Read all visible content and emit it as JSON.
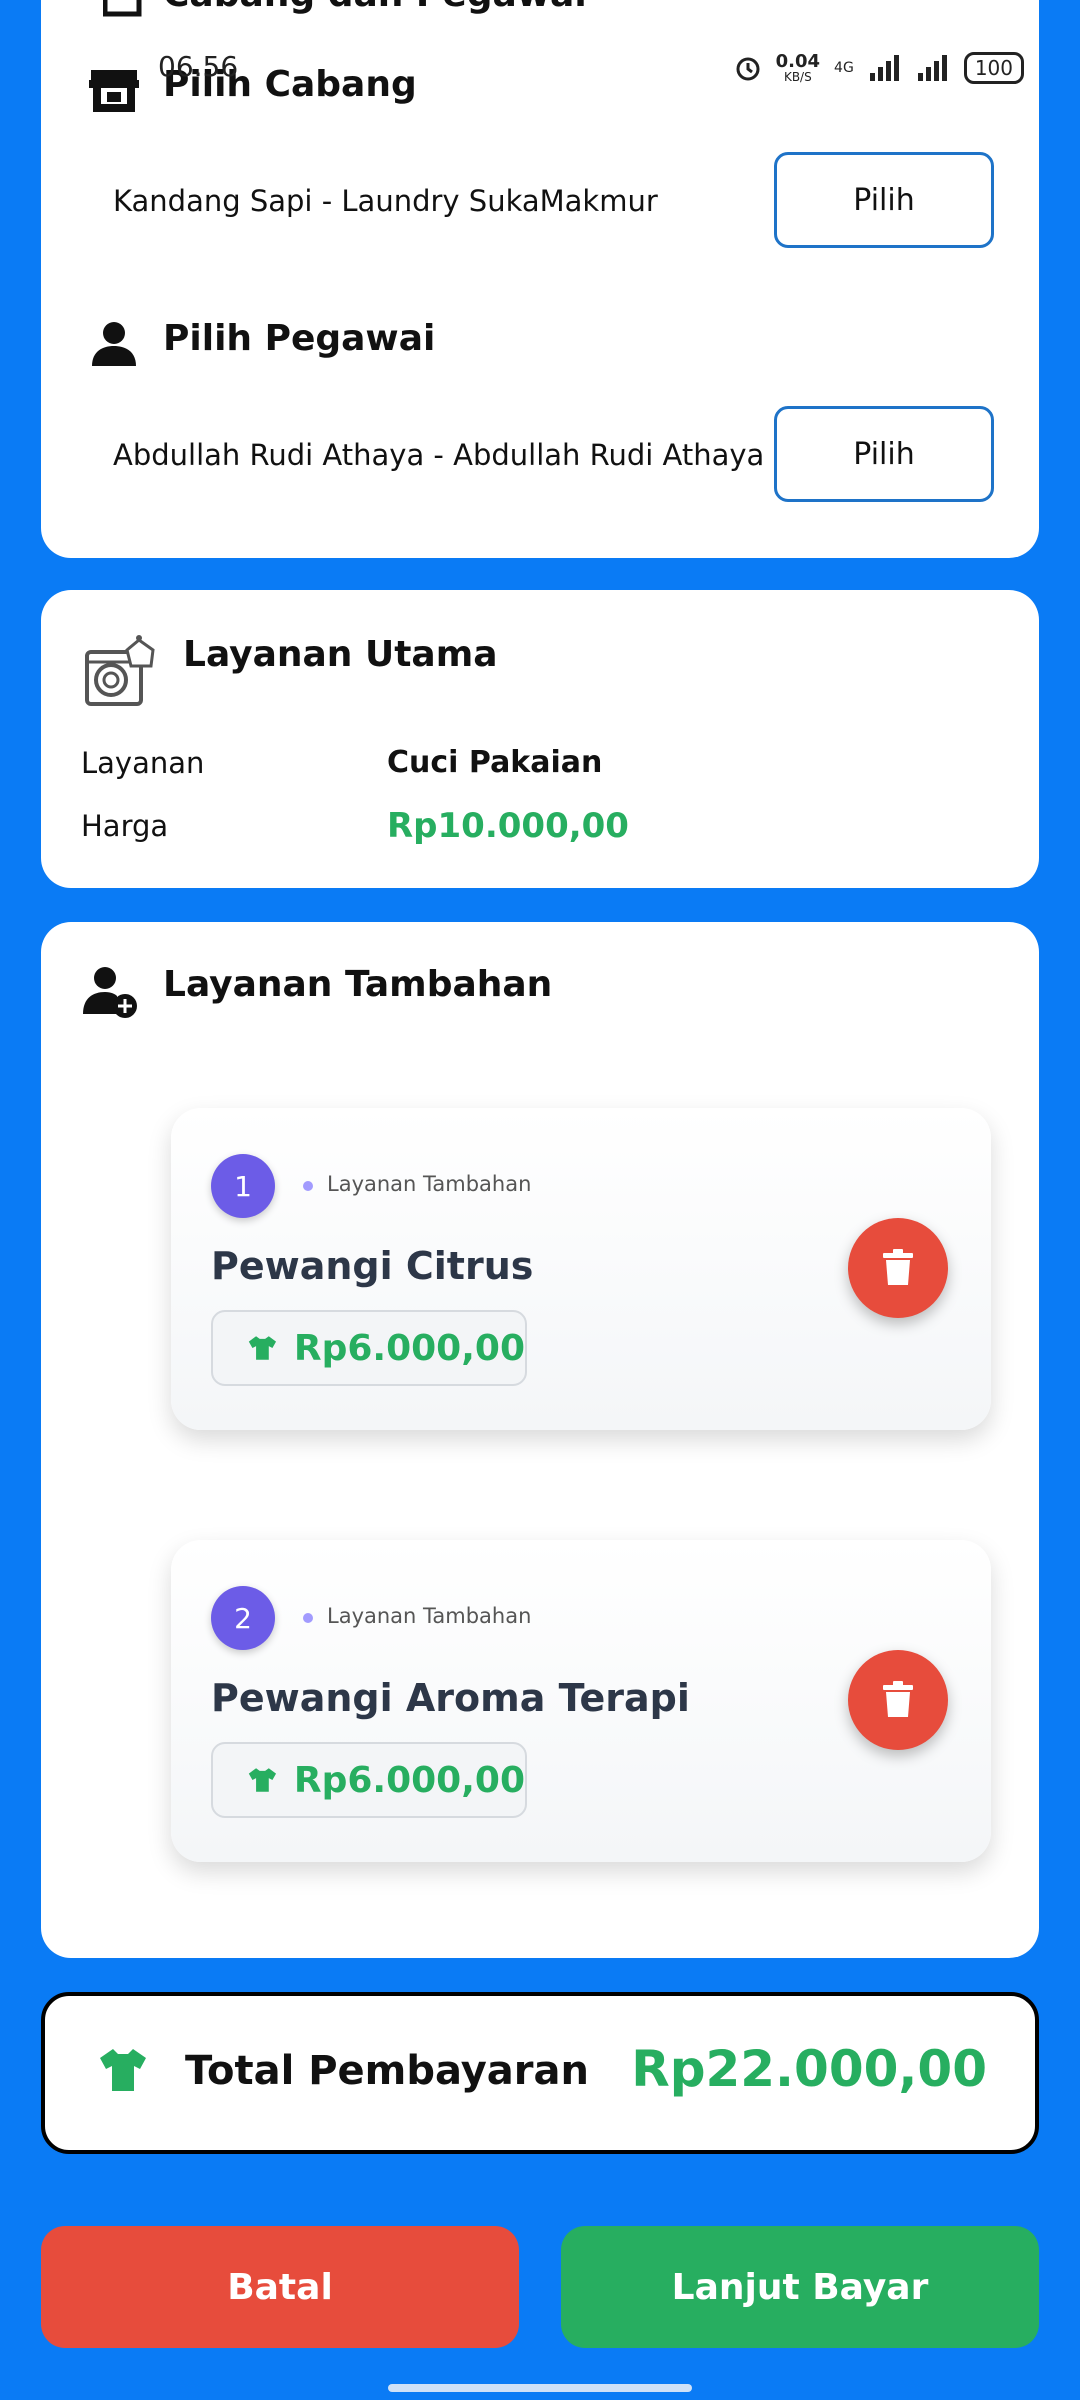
{
  "status_bar": {
    "time": "06.56",
    "net_speed": "0.04",
    "net_unit": "KB/S",
    "network": "4G",
    "battery": "100"
  },
  "branch_employee": {
    "header_partial": "Cabang dan Pegawai",
    "branch_title": "Pilih Cabang",
    "branch_value": "Kandang Sapi - Laundry SukaMakmur",
    "branch_button": "Pilih",
    "employee_title": "Pilih Pegawai",
    "employee_value": "Abdullah Rudi Athaya - Abdullah Rudi Athaya",
    "employee_button": "Pilih"
  },
  "main_service": {
    "title": "Layanan Utama",
    "service_label": "Layanan",
    "service_value": "Cuci Pakaian",
    "price_label": "Harga",
    "price_value": "Rp10.000,00"
  },
  "extra_services": {
    "title": "Layanan Tambahan",
    "items": [
      {
        "number": "1",
        "tag": "Layanan Tambahan",
        "name": "Pewangi Citrus",
        "price": "Rp6.000,00"
      },
      {
        "number": "2",
        "tag": "Layanan Tambahan",
        "name": "Pewangi Aroma Terapi",
        "price": "Rp6.000,00"
      }
    ]
  },
  "total": {
    "label": "Total Pembayaran",
    "value": "Rp22.000,00"
  },
  "actions": {
    "cancel": "Batal",
    "pay": "Lanjut Bayar"
  },
  "colors": {
    "background": "#0a7bf5",
    "price_green": "#27ae60",
    "danger_red": "#e74c3c",
    "badge_purple": "#6c5ce7",
    "button_border": "#1e73c8"
  }
}
